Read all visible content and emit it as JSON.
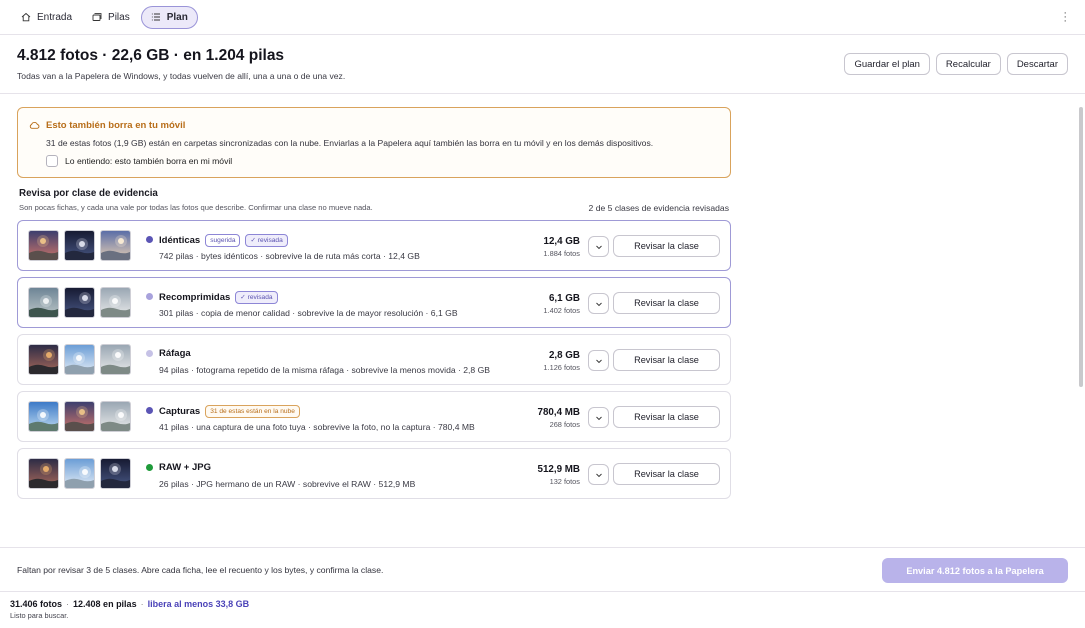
{
  "nav": {
    "tabs": [
      {
        "label": "Entrada",
        "icon": "home-icon"
      },
      {
        "label": "Pilas",
        "icon": "stack-icon"
      },
      {
        "label": "Plan",
        "icon": "list-icon",
        "active": true
      }
    ],
    "more_icon": "kebab-menu-icon"
  },
  "header": {
    "title": "4.812 fotos · 22,6 GB · en 1.204 pilas",
    "subtitle": "Todas van a la Papelera de Windows, y todas vuelven de allí, una a una o de una vez.",
    "buttons": [
      "Guardar el plan",
      "Recalcular",
      "Descartar"
    ]
  },
  "notice": {
    "title": "Esto también borra en tu móvil",
    "body": "31 de estas fotos (1,9 GB) están en carpetas sincronizadas con la nube. Enviarlas a la Papelera aquí también las borra en tu móvil y en los demás dispositivos.",
    "checkbox_label": "Lo entiendo: esto también borra en mi móvil",
    "checked": false,
    "accent": "#b86e1a"
  },
  "section": {
    "title": "Revisa por clase de evidencia",
    "subtitle": "Son pocas fichas, y cada una vale por todas las fotos que describe. Confirmar una clase no mueve nada.",
    "progress": "2 de 5 clases de evidencia revisadas"
  },
  "classes": [
    {
      "name": "Idénticas",
      "dot_color": "#5b55b5",
      "badges": [
        {
          "text": "sugerida",
          "kind": "sug"
        },
        {
          "text": "✓ revisada",
          "kind": "rev"
        }
      ],
      "reviewed": true,
      "description": "742 pilas · bytes idénticos · sobrevive la de ruta más corta · 12,4 GB",
      "size": "12,4 GB",
      "count": "1.884 fotos",
      "button": "Revisar la clase",
      "thumbs": [
        "sunset",
        "night",
        "sunrise"
      ]
    },
    {
      "name": "Recomprimidas",
      "dot_color": "#a8a2dc",
      "badges": [
        {
          "text": "✓ revisada",
          "kind": "rev"
        }
      ],
      "reviewed": true,
      "description": "301 pilas · copia de menor calidad · sobrevive la de mayor resolución · 6,1 GB",
      "size": "6,1 GB",
      "count": "1.402 fotos",
      "button": "Revisar la clase",
      "thumbs": [
        "grey",
        "night",
        "pale"
      ]
    },
    {
      "name": "Ráfaga",
      "dot_color": "#c6c2e6",
      "badges": [],
      "reviewed": false,
      "description": "94 pilas · fotograma repetido de la misma ráfaga · sobrevive la menos movida · 2,8 GB",
      "size": "2,8 GB",
      "count": "1.126 fotos",
      "button": "Revisar la clase",
      "thumbs": [
        "dusk",
        "sky",
        "pale"
      ]
    },
    {
      "name": "Capturas",
      "dot_color": "#5b55b5",
      "badges": [
        {
          "text": "31 de estas están en la nube",
          "kind": "cloud"
        }
      ],
      "reviewed": false,
      "description": "41 pilas · una captura de una foto tuya · sobrevive la foto, no la captura · 780,4 MB",
      "size": "780,4 MB",
      "count": "268 fotos",
      "button": "Revisar la clase",
      "thumbs": [
        "blue",
        "sunset",
        "pale"
      ]
    },
    {
      "name": "RAW + JPG",
      "dot_color": "#1f9b3a",
      "badges": [],
      "reviewed": false,
      "description": "26 pilas · JPG hermano de un RAW · sobrevive el RAW · 512,9 MB",
      "size": "512,9 MB",
      "count": "132 fotos",
      "button": "Revisar la clase",
      "thumbs": [
        "dusk",
        "sky",
        "night"
      ]
    }
  ],
  "actionbar": {
    "text": "Faltan por revisar 3 de 5 clases. Abre cada ficha, lee el recuento y los bytes, y confirma la clase.",
    "send_button": "Enviar 4.812 fotos a la Papelera",
    "send_enabled": false
  },
  "status": {
    "photos": "31.406 fotos",
    "stacks": "12.408 en pilas",
    "free": "libera al menos 33,8 GB",
    "message": "Listo para buscar."
  }
}
